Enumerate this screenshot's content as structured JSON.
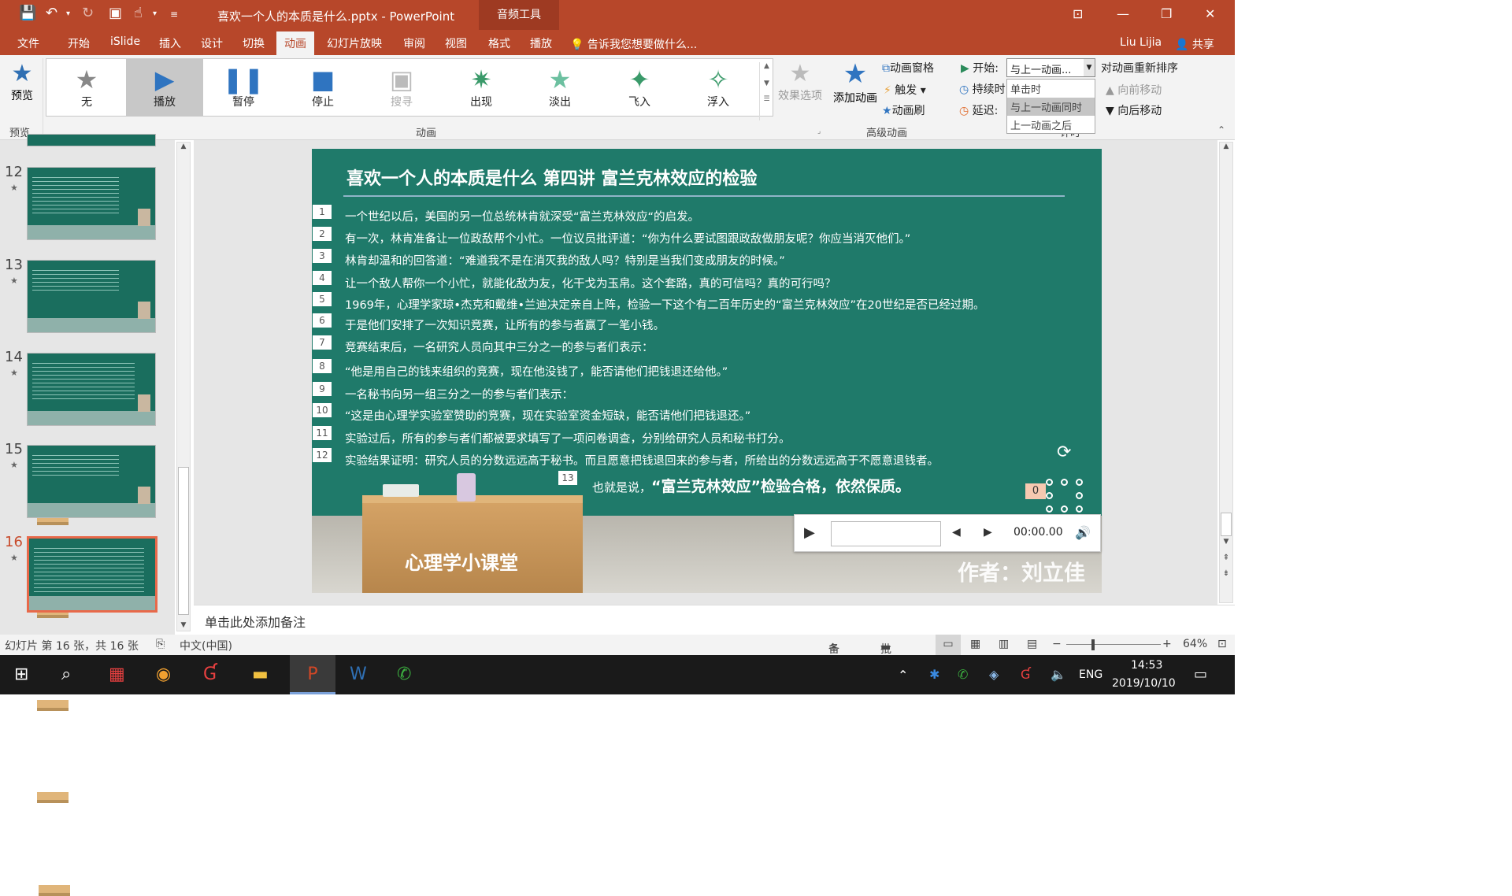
{
  "titlebar": {
    "doc_title": "喜欢一个人的本质是什么.pptx - PowerPoint",
    "context_tab": "音频工具",
    "user": "Liu Lijia",
    "share": "共享"
  },
  "tabs": [
    "文件",
    "开始",
    "iSlide",
    "插入",
    "设计",
    "切换",
    "动画",
    "幻灯片放映",
    "审阅",
    "视图",
    "格式",
    "播放"
  ],
  "tell_me": "告诉我您想要做什么...",
  "ribbon": {
    "preview_label": "预览",
    "preview_group": "预览",
    "gallery": [
      {
        "label": "无",
        "icon": "star-gray-icon"
      },
      {
        "label": "播放",
        "icon": "play-icon"
      },
      {
        "label": "暂停",
        "icon": "pause-icon"
      },
      {
        "label": "停止",
        "icon": "stop-icon"
      },
      {
        "label": "搜寻",
        "icon": "seek-icon"
      },
      {
        "label": "出现",
        "icon": "star-appear-icon"
      },
      {
        "label": "淡出",
        "icon": "star-fade-icon"
      },
      {
        "label": "飞入",
        "icon": "star-fly-icon"
      },
      {
        "label": "浮入",
        "icon": "star-float-icon"
      }
    ],
    "effect_options": "效果选项",
    "animation_group": "动画",
    "add_animation": "添加动画",
    "animation_pane": "动画窗格",
    "trigger": "触发",
    "animation_painter": "动画刷",
    "advanced_group": "高级动画",
    "start_label": "开始:",
    "start_value": "与上一动画...",
    "duration_label": "持续时",
    "delay_label": "延迟:",
    "start_options": [
      "单击时",
      "与上一动画同时",
      "上一动画之后"
    ],
    "reorder": "对动画重新排序",
    "move_earlier": "向前移动",
    "move_later": "向后移动",
    "timing_group_partial": "计时"
  },
  "thumbnails": [
    {
      "num": "12"
    },
    {
      "num": "13"
    },
    {
      "num": "14"
    },
    {
      "num": "15"
    },
    {
      "num": "16"
    }
  ],
  "slide": {
    "title": "喜欢一个人的本质是什么  第四讲  富兰克林效应的检验",
    "lines": [
      {
        "n": "1",
        "t": "一个世纪以后，美国的另一位总统林肯就深受“富兰克林效应“的启发。"
      },
      {
        "n": "2",
        "t": "有一次，林肯准备让一位政敌帮个小忙。一位议员批评道：“你为什么要试图跟政敌做朋友呢？你应当消灭他们。”"
      },
      {
        "n": "3",
        "t": "林肯却温和的回答道：“难道我不是在消灭我的敌人吗？特别是当我们变成朋友的时候。”"
      },
      {
        "n": "4",
        "t": "让一个敌人帮你一个小忙，就能化敌为友，化干戈为玉帛。这个套路，真的可信吗？真的可行吗？"
      },
      {
        "n": "5",
        "t": "1969年，心理学家琼•杰克和戴维•兰迪决定亲自上阵，检验一下这个有二百年历史的“富兰克林效应”在20世纪是否已经过期。"
      },
      {
        "n": "6",
        "t": "于是他们安排了一次知识竞赛，让所有的参与者赢了一笔小钱。"
      },
      {
        "n": "7",
        "t": "竞赛结束后，一名研究人员向其中三分之一的参与者们表示："
      },
      {
        "n": "8",
        "t": "“他是用自己的钱来组织的竞赛，现在他没钱了，能否请他们把钱退还给他。”"
      },
      {
        "n": "9",
        "t": "一名秘书向另一组三分之一的参与者们表示："
      },
      {
        "n": "10",
        "t": "“这是由心理学实验室赞助的竞赛，现在实验室资金短缺，能否请他们把钱退还。”"
      },
      {
        "n": "11",
        "t": "实验过后，所有的参与者们都被要求填写了一项问卷调查，分别给研究人员和秘书打分。"
      },
      {
        "n": "12",
        "t": "实验结果证明：研究人员的分数远远高于秘书。而且愿意把钱退回来的参与者，所给出的分数远远高于不愿意退钱者。"
      }
    ],
    "last_num": "13",
    "last_pre": "也就是说，",
    "last_main": "“富兰克林效应”检验合格，依然保质。",
    "desk_text": "心理学小课堂",
    "author": "作者：刘立佳",
    "anim_tag": "0",
    "player_time": "00:00.00"
  },
  "notes_placeholder": "单击此处添加备注",
  "status": {
    "slide_info": "幻灯片 第 16 张，共 16 张",
    "language": "中文(中国)",
    "notes": "备注",
    "comments": "批注",
    "zoom": "64%"
  },
  "taskbar": {
    "lang": "ENG",
    "time": "14:53",
    "date": "2019/10/10"
  }
}
